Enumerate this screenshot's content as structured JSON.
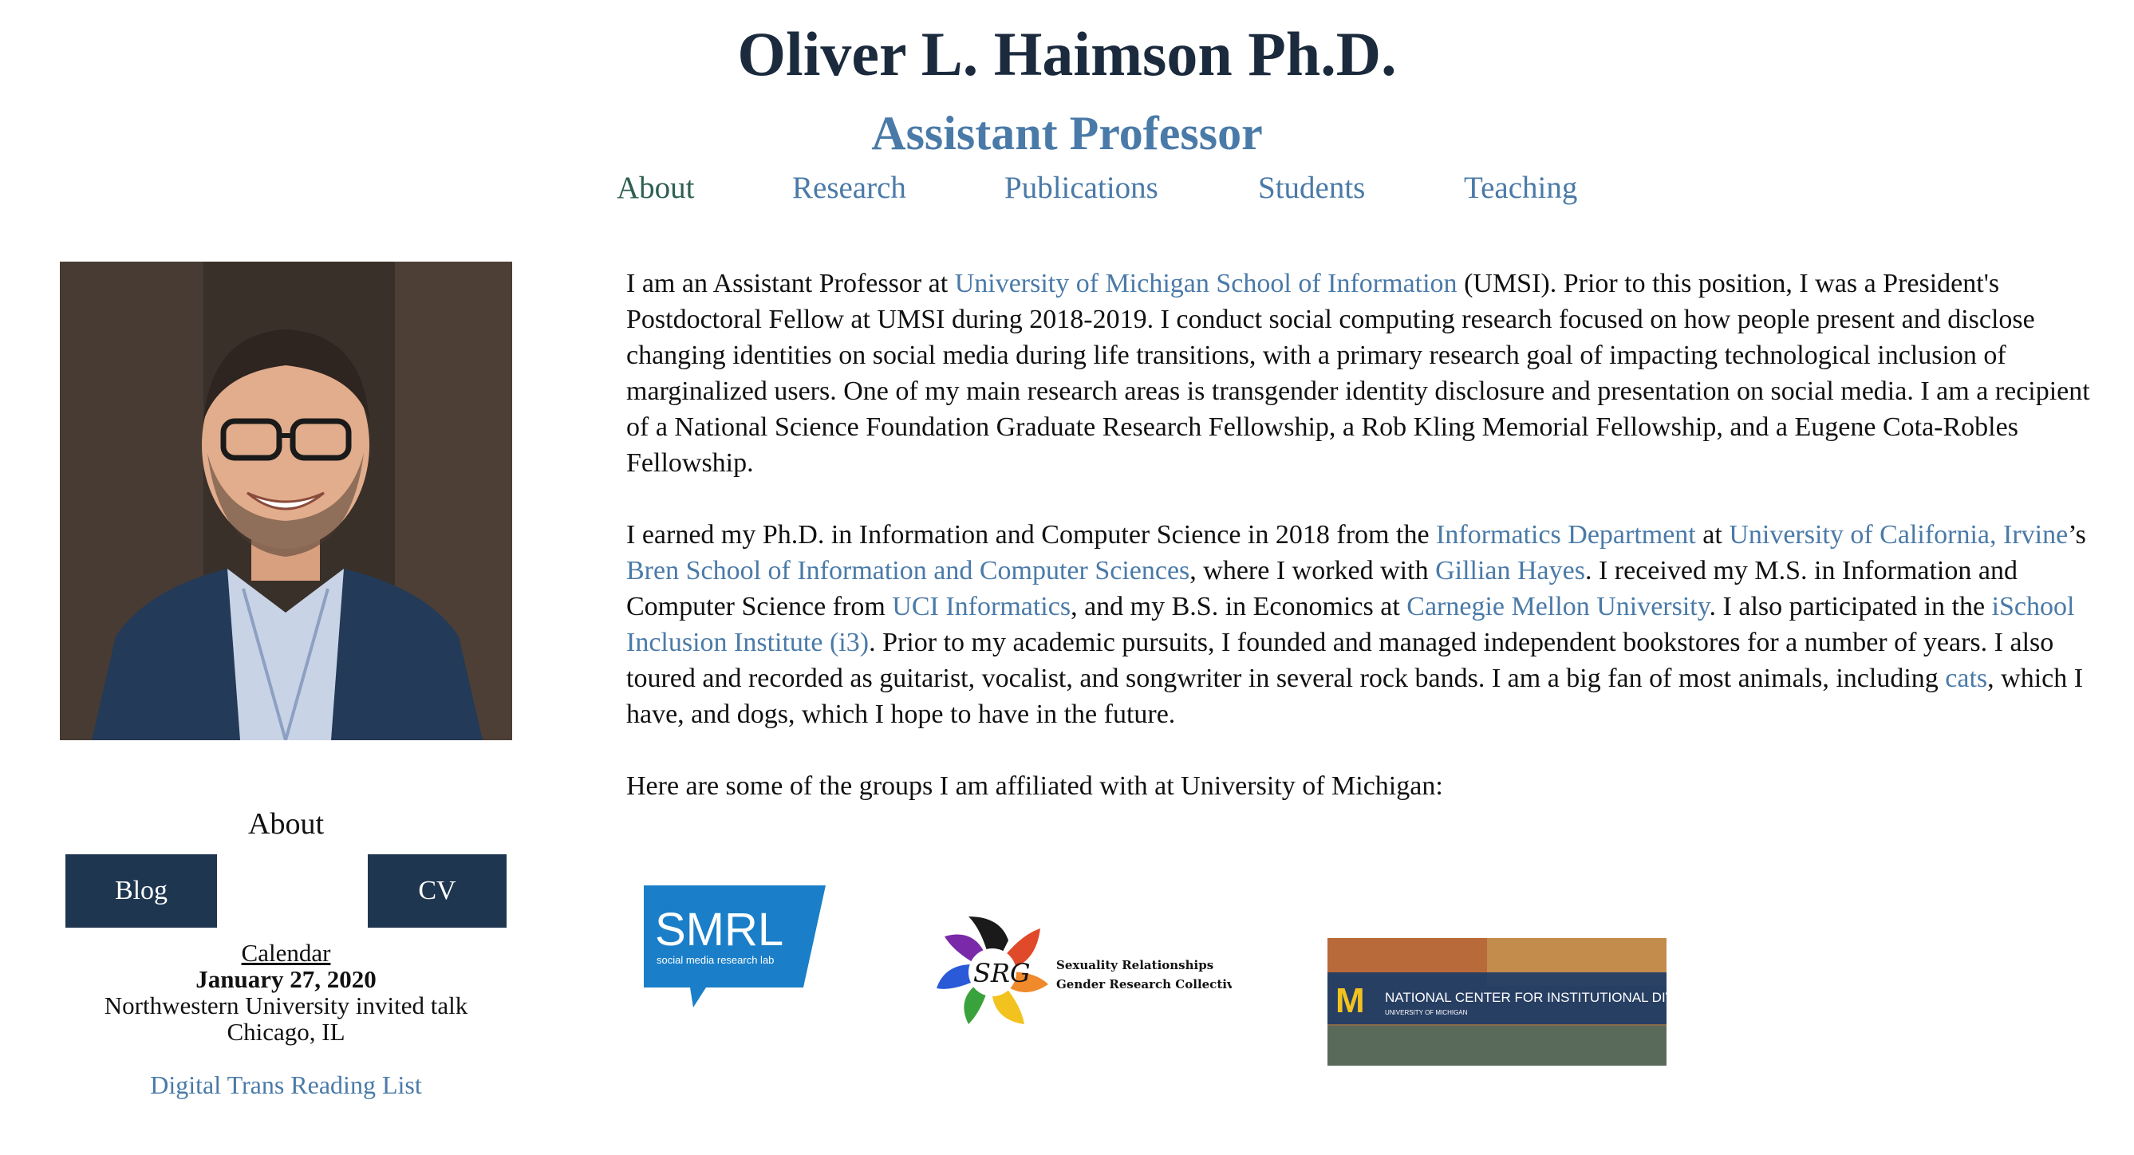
{
  "header": {
    "name": "Oliver L. Haimson Ph.D.",
    "title": "Assistant Professor"
  },
  "nav": {
    "items": [
      {
        "label": "About",
        "current": true
      },
      {
        "label": "Research"
      },
      {
        "label": "Publications"
      },
      {
        "label": "Students"
      },
      {
        "label": "Teaching"
      }
    ]
  },
  "sidebar": {
    "about_label": "About",
    "blog_button": "Blog",
    "cv_button": "CV",
    "calendar": {
      "title": "Calendar",
      "date": "January 27, 2020",
      "event": "Northwestern University invited talk",
      "location": "Chicago, IL"
    },
    "reading_list": "Digital Trans Reading List"
  },
  "bio": {
    "p1": {
      "t1": "I am an Assistant Professor at ",
      "l1": "University of Michigan School of Information",
      "t2": " (UMSI). Prior to this position, I was a President's Postdoctoral Fellow at UMSI during 2018-2019. I conduct social computing research focused on how people present and disclose changing identities on social media during life transitions, with a primary research goal of impacting technological inclusion of marginalized users. One of my main research areas is transgender identity disclosure and presentation on social media. I am a recipient of a National Science Foundation Graduate Research Fellowship, a Rob Kling Memorial Fellowship, and a Eugene Cota-Robles Fellowship."
    },
    "p2": {
      "t1": "I earned my Ph.D. in Information and Computer Science in 2018 from the ",
      "l1": "Informatics Department",
      "t2": " at ",
      "l2": "University of California, Irvine",
      "t3": "’s ",
      "l3": "Bren School of Information and Computer Sciences",
      "t4": ", where I worked with ",
      "l4": "Gillian Hayes",
      "t5": ". I received my M.S. in Information and Computer Science from ",
      "l5": "UCI Informatics",
      "t6": ", and my B.S. in Economics at ",
      "l6": "Carnegie Mellon University",
      "t7": ". I also participated in the ",
      "l7": "iSchool Inclusion Institute (i3)",
      "t8": ". Prior to my academic pursuits, I founded and managed independent bookstores for a number of years. I also toured and recorded as guitarist, vocalist, and songwriter in several rock bands. I am a big fan of most animals, including ",
      "l8": "cats",
      "t9": ", which I have, and dogs, which I hope to have in the future."
    },
    "p3": "Here are some of the groups I am affiliated with at University of Michigan:"
  },
  "logos": {
    "smrl": {
      "abbr": "SMRL",
      "sub": "social media research lab",
      "color": "#1a7fc8"
    },
    "srg": {
      "abbr": "SRG",
      "line1": "Sexuality Relationships",
      "line2": "Gender Research Collective"
    },
    "ncid": {
      "block_m": "M",
      "name": "NATIONAL CENTER FOR INSTITUTIONAL DIVERSITY",
      "sub": "UNIVERSITY OF MICHIGAN"
    }
  }
}
